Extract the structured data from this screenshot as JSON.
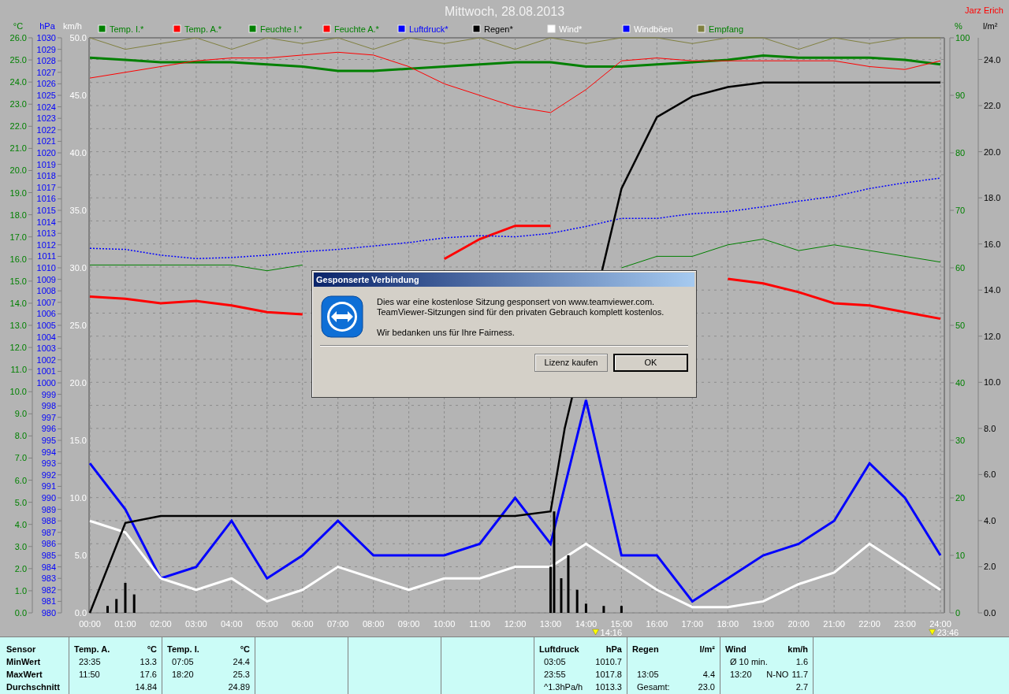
{
  "chart": {
    "title": "Mittwoch, 28.08.2013",
    "owner": "Jarz Erich",
    "legend": [
      {
        "label": "Temp. I.*",
        "color": "#008000"
      },
      {
        "label": "Temp. A.*",
        "color": "#ff0000"
      },
      {
        "label": "Feuchte I.*",
        "color": "#008000"
      },
      {
        "label": "Feuchte A.*",
        "color": "#ff0000"
      },
      {
        "label": "Luftdruck*",
        "color": "#0000ff"
      },
      {
        "label": "Regen*",
        "color": "#000000"
      },
      {
        "label": "Wind*",
        "color": "#ffffff"
      },
      {
        "label": "Windböen",
        "color": "#0000ff"
      },
      {
        "label": "Empfang",
        "color": "#808040"
      }
    ],
    "panels": [
      {
        "chart_data": {
          "type": "line",
          "ylabel": "°C",
          "grid": true,
          "x": [
            0,
            1,
            2,
            3,
            4,
            5,
            6,
            7,
            8,
            9,
            10,
            11,
            12,
            13,
            14,
            15,
            16,
            17,
            18,
            19,
            20,
            21,
            22,
            23,
            24
          ],
          "xlim": [
            0,
            24
          ],
          "xticks": [
            {
              "value": 0,
              "label": "00:00"
            },
            {
              "value": 1,
              "label": "01:00"
            },
            {
              "value": 2,
              "label": "02:00"
            },
            {
              "value": 3,
              "label": "03:00"
            },
            {
              "value": 4,
              "label": "04:00"
            },
            {
              "value": 5,
              "label": "05:00"
            },
            {
              "value": 6,
              "label": "06:00"
            },
            {
              "value": 7,
              "label": "07:00"
            },
            {
              "value": 8,
              "label": "08:00"
            },
            {
              "value": 9,
              "label": "09:00"
            },
            {
              "value": 10,
              "label": "10:00"
            },
            {
              "value": 11,
              "label": "11:00"
            },
            {
              "value": 12,
              "label": "12:00"
            },
            {
              "value": 13,
              "label": "13:00"
            },
            {
              "value": 14,
              "label": "14:00"
            },
            {
              "value": 15,
              "label": "15:00"
            },
            {
              "value": 16,
              "label": "16:00"
            },
            {
              "value": 17,
              "label": "17:00"
            },
            {
              "value": 18,
              "label": "18:00"
            },
            {
              "value": 19,
              "label": "19:00"
            },
            {
              "value": 20,
              "label": "20:00"
            },
            {
              "value": 21,
              "label": "21:00"
            },
            {
              "value": 22,
              "label": "22:00"
            },
            {
              "value": 23,
              "label": "23:00"
            },
            {
              "value": 24,
              "label": "24:00"
            }
          ],
          "ylim": [
            0,
            26
          ],
          "yticks": [
            {
              "value": 26,
              "label": "26.0"
            },
            {
              "value": 25,
              "label": "25.0"
            },
            {
              "value": 24,
              "label": "24.0"
            },
            {
              "value": 23,
              "label": "23.0"
            },
            {
              "value": 22,
              "label": "22.0"
            },
            {
              "value": 21,
              "label": "21.0"
            },
            {
              "value": 20,
              "label": "20.0"
            },
            {
              "value": 19,
              "label": "19.0"
            },
            {
              "value": 18,
              "label": "18.0"
            },
            {
              "value": 17,
              "label": "17.0"
            },
            {
              "value": 16,
              "label": "16.0"
            },
            {
              "value": 15,
              "label": "15.0"
            },
            {
              "value": 14,
              "label": "14.0"
            },
            {
              "value": 13,
              "label": "13.0"
            },
            {
              "value": 12,
              "label": "12.0"
            },
            {
              "value": 11,
              "label": "11.0"
            },
            {
              "value": 10,
              "label": "10.0"
            },
            {
              "value": 9,
              "label": "9.0"
            },
            {
              "value": 8,
              "label": "8.0"
            },
            {
              "value": 7,
              "label": "7.0"
            },
            {
              "value": 6,
              "label": "6.0"
            },
            {
              "value": 5,
              "label": "5.0"
            },
            {
              "value": 4,
              "label": "4.0"
            },
            {
              "value": 3,
              "label": "3.0"
            },
            {
              "value": 2,
              "label": "2.0"
            },
            {
              "value": 1,
              "label": "1.0"
            },
            {
              "value": 0,
              "label": "0.0"
            }
          ],
          "series": [
            {
              "color": "#008000",
              "values": [
                25.1,
                25.0,
                24.9,
                24.9,
                24.9,
                24.8,
                24.7,
                24.5,
                24.5,
                24.6,
                24.7,
                24.8,
                24.9,
                24.9,
                24.7,
                24.7,
                24.8,
                24.9,
                25.0,
                25.2,
                25.1,
                25.1,
                25.1,
                25.0,
                24.8
              ]
            },
            {
              "color": "#ff0000",
              "values": [
                14.3,
                14.2,
                14.0,
                14.1,
                13.9,
                13.6,
                13.5,
                null,
                null,
                null,
                16.0,
                16.9,
                17.5,
                17.5,
                null,
                null,
                null,
                null,
                15.1,
                14.9,
                14.5,
                14.0,
                13.9,
                13.6,
                13.3
              ]
            }
          ],
          "annotations": [
            "14:16",
            "23:46"
          ]
        }
      },
      {
        "chart_data": {
          "type": "line",
          "ylabel": "hPa",
          "x": [
            0,
            1,
            2,
            3,
            4,
            5,
            6,
            7,
            8,
            9,
            10,
            11,
            12,
            13,
            14,
            15,
            16,
            17,
            18,
            19,
            20,
            21,
            22,
            23,
            24
          ],
          "xlim": [
            0,
            24
          ],
          "ylim": [
            980,
            1030
          ],
          "yticks": [
            {
              "value": 1030,
              "label": "1030"
            },
            {
              "value": 1029,
              "label": "1029"
            },
            {
              "value": 1028,
              "label": "1028"
            },
            {
              "value": 1027,
              "label": "1027"
            },
            {
              "value": 1026,
              "label": "1026"
            },
            {
              "value": 1025,
              "label": "1025"
            },
            {
              "value": 1024,
              "label": "1024"
            },
            {
              "value": 1023,
              "label": "1023"
            },
            {
              "value": 1022,
              "label": "1022"
            },
            {
              "value": 1021,
              "label": "1021"
            },
            {
              "value": 1020,
              "label": "1020"
            },
            {
              "value": 1019,
              "label": "1019"
            },
            {
              "value": 1018,
              "label": "1018"
            },
            {
              "value": 1017,
              "label": "1017"
            },
            {
              "value": 1016,
              "label": "1016"
            },
            {
              "value": 1015,
              "label": "1015"
            },
            {
              "value": 1014,
              "label": "1014"
            },
            {
              "value": 1013,
              "label": "1013"
            },
            {
              "value": 1012,
              "label": "1012"
            },
            {
              "value": 1011,
              "label": "1011"
            },
            {
              "value": 1010,
              "label": "1010"
            },
            {
              "value": 1009,
              "label": "1009"
            },
            {
              "value": 1008,
              "label": "1008"
            },
            {
              "value": 1007,
              "label": "1007"
            },
            {
              "value": 1006,
              "label": "1006"
            },
            {
              "value": 1005,
              "label": "1005"
            },
            {
              "value": 1004,
              "label": "1004"
            },
            {
              "value": 1003,
              "label": "1003"
            },
            {
              "value": 1002,
              "label": "1002"
            },
            {
              "value": 1001,
              "label": "1001"
            },
            {
              "value": 1000,
              "label": "1000"
            },
            {
              "value": 999,
              "label": "999"
            },
            {
              "value": 998,
              "label": "998"
            },
            {
              "value": 997,
              "label": "997"
            },
            {
              "value": 996,
              "label": "996"
            },
            {
              "value": 995,
              "label": "995"
            },
            {
              "value": 994,
              "label": "994"
            },
            {
              "value": 993,
              "label": "993"
            },
            {
              "value": 992,
              "label": "992"
            },
            {
              "value": 991,
              "label": "991"
            },
            {
              "value": 990,
              "label": "990"
            },
            {
              "value": 989,
              "label": "989"
            },
            {
              "value": 988,
              "label": "988"
            },
            {
              "value": 987,
              "label": "987"
            },
            {
              "value": 986,
              "label": "986"
            },
            {
              "value": 985,
              "label": "985"
            },
            {
              "value": 984,
              "label": "984"
            },
            {
              "value": 983,
              "label": "983"
            },
            {
              "value": 982,
              "label": "982"
            },
            {
              "value": 981,
              "label": "981"
            },
            {
              "value": 980,
              "label": "980"
            }
          ],
          "series": [
            {
              "color": "#0000ff",
              "line_style": "dotted",
              "values": [
                1011.7,
                1011.6,
                1011.1,
                1010.8,
                1010.9,
                1011.1,
                1011.4,
                1011.6,
                1011.9,
                1012.2,
                1012.6,
                1012.8,
                1012.7,
                1013.0,
                1013.6,
                1014.3,
                1014.3,
                1014.7,
                1014.9,
                1015.3,
                1015.8,
                1016.2,
                1016.9,
                1017.4,
                1017.8
              ]
            }
          ]
        }
      },
      {
        "chart_data": {
          "type": "line",
          "ylabel": "km/h",
          "x": [
            0,
            1,
            2,
            3,
            4,
            5,
            6,
            7,
            8,
            9,
            10,
            11,
            12,
            13,
            14,
            15,
            16,
            17,
            18,
            19,
            20,
            21,
            22,
            23,
            24
          ],
          "xlim": [
            0,
            24
          ],
          "ylim": [
            0,
            50
          ],
          "yticks": [
            {
              "value": 50,
              "label": "50.0"
            },
            {
              "value": 45,
              "label": "45.0"
            },
            {
              "value": 40,
              "label": "40.0"
            },
            {
              "value": 35,
              "label": "35.0"
            },
            {
              "value": 30,
              "label": "30.0"
            },
            {
              "value": 25,
              "label": "25.0"
            },
            {
              "value": 20,
              "label": "20.0"
            },
            {
              "value": 15,
              "label": "15.0"
            },
            {
              "value": 10,
              "label": "10.0"
            },
            {
              "value": 5,
              "label": "5.0"
            },
            {
              "value": 0,
              "label": "0.0"
            }
          ],
          "series": [
            {
              "color": "#0000ff",
              "values": [
                13,
                9,
                3,
                4,
                8,
                3,
                5,
                8,
                5,
                5,
                5,
                6,
                10,
                6,
                18.5,
                5,
                5,
                1,
                3,
                5,
                6,
                8,
                13,
                10,
                5
              ]
            },
            {
              "color": "#ffffff",
              "values": [
                8,
                7,
                3,
                2,
                3,
                1,
                2,
                4,
                3,
                2,
                3,
                3,
                4,
                4,
                6,
                4,
                2,
                0.5,
                0.5,
                1,
                2.5,
                3.5,
                6,
                4,
                2
              ]
            }
          ]
        }
      },
      {
        "chart_data": {
          "type": "line",
          "ylabel": "%",
          "x": [
            0,
            1,
            2,
            3,
            4,
            5,
            6,
            7,
            8,
            9,
            10,
            11,
            12,
            13,
            14,
            15,
            16,
            17,
            18,
            19,
            20,
            21,
            22,
            23,
            24
          ],
          "xlim": [
            0,
            24
          ],
          "ylim": [
            0,
            100
          ],
          "yticks": [
            {
              "value": 100,
              "label": "100"
            },
            {
              "value": 90,
              "label": "90"
            },
            {
              "value": 80,
              "label": "80"
            },
            {
              "value": 70,
              "label": "70"
            },
            {
              "value": 60,
              "label": "60"
            },
            {
              "value": 50,
              "label": "50"
            },
            {
              "value": 40,
              "label": "40"
            },
            {
              "value": 30,
              "label": "30"
            },
            {
              "value": 20,
              "label": "20"
            },
            {
              "value": 10,
              "label": "10"
            },
            {
              "value": 0,
              "label": "0"
            }
          ],
          "series": [
            {
              "color": "#808040",
              "values": [
                100,
                98,
                99,
                100,
                98,
                100,
                99,
                100,
                98,
                100,
                99,
                100,
                98,
                100,
                99,
                100,
                100,
                99,
                100,
                100,
                98,
                100,
                99,
                100,
                100
              ]
            },
            {
              "color": "#008000",
              "values": [
                60.5,
                60.5,
                60.5,
                60.5,
                60.5,
                59.5,
                60.5,
                null,
                null,
                null,
                null,
                null,
                null,
                null,
                null,
                60,
                62,
                62,
                64,
                65,
                63,
                64,
                63,
                62,
                61
              ]
            },
            {
              "color": "#ff0000",
              "values": [
                93,
                94,
                95,
                96,
                96.5,
                96.5,
                97,
                97.5,
                97,
                95,
                92,
                90,
                88,
                87,
                91,
                96,
                96.5,
                96,
                96,
                96,
                96,
                96,
                95,
                94.5,
                96
              ]
            }
          ]
        }
      },
      {
        "chart_data": {
          "type": "line",
          "ylabel": "l/m²",
          "x": [
            0,
            1,
            2,
            3,
            4,
            5,
            6,
            7,
            8,
            9,
            10,
            11,
            12,
            13,
            13.4,
            15,
            16,
            17,
            18,
            19,
            20,
            21,
            22,
            23,
            24
          ],
          "xlim": [
            0,
            24
          ],
          "ylim": [
            0,
            24.94
          ],
          "yticks": [
            {
              "value": 24,
              "label": "24.0"
            },
            {
              "value": 22,
              "label": "22.0"
            },
            {
              "value": 20,
              "label": "20.0"
            },
            {
              "value": 18,
              "label": "18.0"
            },
            {
              "value": 16,
              "label": "16.0"
            },
            {
              "value": 14,
              "label": "14.0"
            },
            {
              "value": 12,
              "label": "12.0"
            },
            {
              "value": 10,
              "label": "10.0"
            },
            {
              "value": 8,
              "label": "8.0"
            },
            {
              "value": 6,
              "label": "6.0"
            },
            {
              "value": 4,
              "label": "4.0"
            },
            {
              "value": 2,
              "label": "2.0"
            },
            {
              "value": 0,
              "label": "0.0"
            }
          ],
          "series": [
            {
              "color": "#000000",
              "values": [
                0,
                3.9,
                4.2,
                4.2,
                4.2,
                4.2,
                4.2,
                4.2,
                4.2,
                4.2,
                4.2,
                4.2,
                4.2,
                4.4,
                8.0,
                18.4,
                21.5,
                22.4,
                22.8,
                23.0,
                23.0,
                23.0,
                23.0,
                23.0,
                23.0
              ]
            }
          ]
        }
      },
      {
        "chart_data": {
          "type": "bar",
          "x": [
            0.5,
            0.75,
            1,
            1.25,
            13,
            13.1,
            13.3,
            13.5,
            13.75,
            14,
            14.5,
            15
          ],
          "xlim": [
            0,
            24
          ],
          "ylim": [
            0,
            24.94
          ],
          "series": [
            {
              "color": "#000000",
              "values": [
                0.3,
                0.6,
                1.3,
                0.8,
                2.0,
                4.4,
                1.5,
                2.5,
                1.0,
                0.4,
                0.3,
                0.3
              ]
            }
          ]
        }
      }
    ]
  },
  "dialog": {
    "title": "Gesponserte Verbindung",
    "lines": [
      "Dies war eine kostenlose Sitzung gesponsert von www.teamviewer.com.",
      "TeamViewer-Sitzungen sind für den privaten Gebrauch komplett kostenlos."
    ],
    "thanks": "Wir bedanken uns für Ihre Fairness.",
    "buttons": [
      {
        "label": "Lizenz kaufen",
        "default": false
      },
      {
        "label": "OK",
        "default": true
      }
    ]
  },
  "summary_table": {
    "row_labels": [
      "Sensor",
      "MinWert",
      "MaxWert",
      "Durchschnitt"
    ],
    "columns": [
      {
        "kind": "sensor",
        "title": "Temp. A.",
        "unit": "°C",
        "rows": [
          {
            "time": "23:35",
            "value": "13.3"
          },
          {
            "time": "11:50",
            "value": "17.6"
          },
          {
            "value": "14.84"
          }
        ]
      },
      {
        "kind": "sensor",
        "title": "Temp. I.",
        "unit": "°C",
        "rows": [
          {
            "time": "07:05",
            "value": "24.4"
          },
          {
            "time": "18:20",
            "value": "25.3"
          },
          {
            "value": "24.89"
          }
        ]
      },
      {
        "kind": "empty"
      },
      {
        "kind": "empty"
      },
      {
        "kind": "empty"
      },
      {
        "kind": "sensor",
        "title": "Luftdruck",
        "unit": "hPa",
        "rows": [
          {
            "time": "03:05",
            "value": "1010.7"
          },
          {
            "time": "23:55",
            "value": "1017.8"
          },
          {
            "time": "^1.3hPa/h",
            "value": "1013.3"
          }
        ]
      },
      {
        "kind": "sensor",
        "title": "Regen",
        "unit": "l/m²",
        "rows": [
          {},
          {
            "time": "13:05",
            "value": "4.4"
          },
          {
            "time": "Gesamt:",
            "value": "23.0"
          }
        ]
      },
      {
        "kind": "sensor",
        "title": "Wind",
        "unit": "km/h",
        "rows": [
          {
            "time": "Ø 10 min.",
            "value": "1.6"
          },
          {
            "time": "13:20",
            "extra": "N-NO",
            "value": "11.7"
          },
          {
            "value": "2.7"
          }
        ]
      },
      {
        "kind": "filler"
      }
    ]
  }
}
